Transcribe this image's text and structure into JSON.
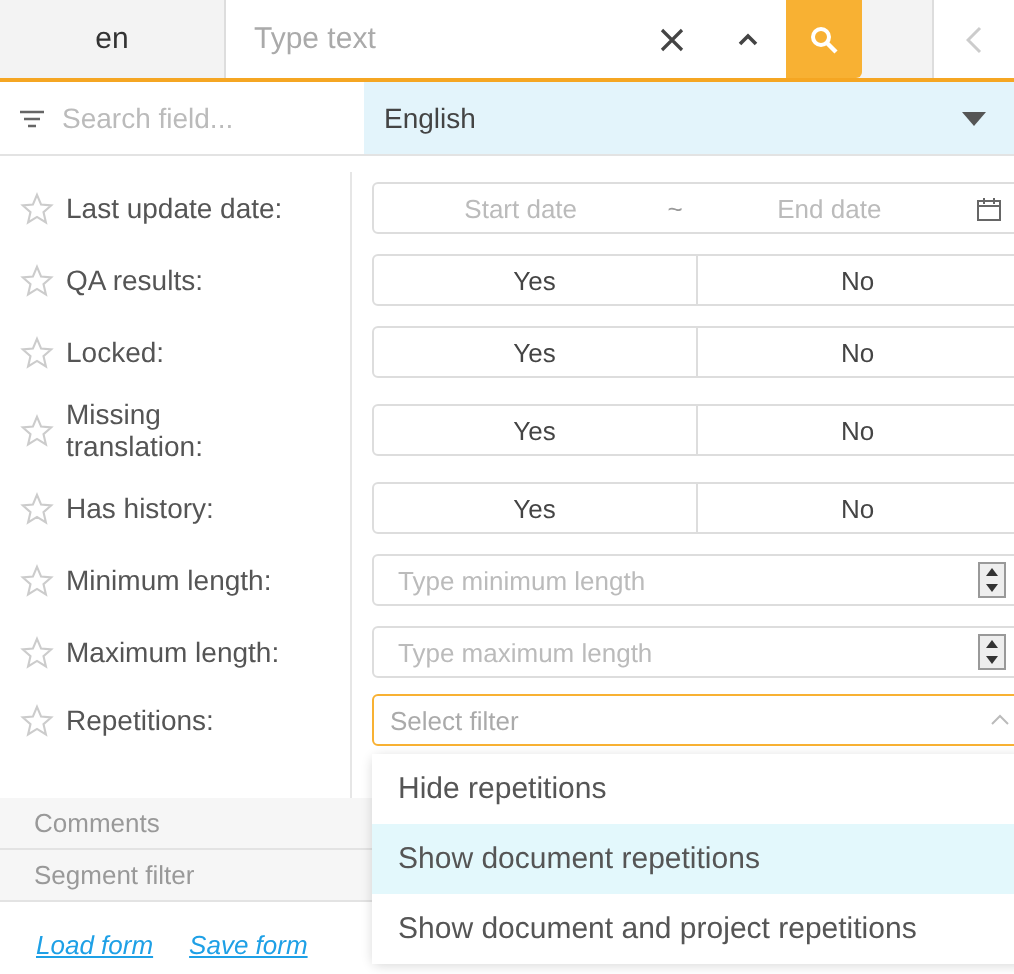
{
  "top_bar": {
    "language": "en",
    "search": {
      "placeholder": "Type text"
    }
  },
  "field_search": {
    "placeholder": "Search field..."
  },
  "language_select": {
    "value": "English"
  },
  "fields": [
    {
      "label": "Last update date:",
      "starred": false,
      "kind": "date_range",
      "start_placeholder": "Start date",
      "separator": "~",
      "end_placeholder": "End date"
    },
    {
      "label": "QA results:",
      "starred": false,
      "kind": "yes_no",
      "options": [
        {
          "label": "Yes",
          "selected": false
        },
        {
          "label": "No",
          "selected": false
        }
      ]
    },
    {
      "label": "Locked:",
      "starred": false,
      "kind": "yes_no",
      "options": [
        {
          "label": "Yes",
          "selected": false
        },
        {
          "label": "No",
          "selected": false
        }
      ]
    },
    {
      "label": "Missing translation:",
      "starred": false,
      "kind": "yes_no",
      "options": [
        {
          "label": "Yes",
          "selected": false
        },
        {
          "label": "No",
          "selected": false
        }
      ]
    },
    {
      "label": "Has history:",
      "starred": false,
      "kind": "yes_no",
      "options": [
        {
          "label": "Yes",
          "selected": false
        },
        {
          "label": "No",
          "selected": false
        }
      ]
    },
    {
      "label": "Minimum length:",
      "starred": false,
      "kind": "number",
      "placeholder": "Type minimum length"
    },
    {
      "label": "Maximum length:",
      "starred": false,
      "kind": "number",
      "placeholder": "Type maximum length"
    },
    {
      "label": "Repetitions:",
      "starred": false,
      "kind": "select",
      "placeholder": "Select filter",
      "expanded": true,
      "options": [
        {
          "label": "Hide repetitions",
          "selected": false
        },
        {
          "label": "Show document repetitions",
          "selected": true
        },
        {
          "label": "Show document and project repetitions",
          "selected": false
        }
      ]
    }
  ],
  "sections": [
    "Comments",
    "Segment filter"
  ],
  "links": [
    "Load form",
    "Save form"
  ]
}
